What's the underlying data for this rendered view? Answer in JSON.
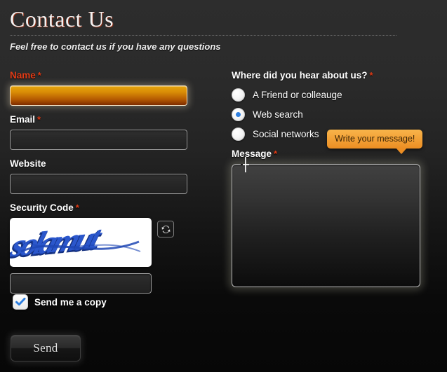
{
  "header": {
    "title": "Contact Us",
    "subtitle": "Feel free to contact us if you have any questions"
  },
  "form": {
    "name": {
      "label": "Name",
      "required_mark": "*",
      "value": "",
      "placeholder": ""
    },
    "email": {
      "label": "Email",
      "required_mark": "*",
      "value": "",
      "placeholder": ""
    },
    "website": {
      "label": "Website",
      "required_mark": "",
      "value": "",
      "placeholder": ""
    },
    "security_code": {
      "label": "Security Code",
      "required_mark": "*",
      "value": "",
      "placeholder": "",
      "captcha_text": "solamut",
      "refresh_icon": "refresh-icon"
    },
    "send_copy": {
      "label": "Send me a copy",
      "checked": true,
      "check_icon": "check-icon"
    },
    "submit": {
      "label": "Send"
    }
  },
  "survey": {
    "label": "Where did you hear about us?",
    "required_mark": "*",
    "options": [
      {
        "label": "A Friend or colleauge",
        "selected": false
      },
      {
        "label": "Web search",
        "selected": true
      },
      {
        "label": "Social networks",
        "selected": false
      }
    ]
  },
  "message": {
    "label": "Message",
    "required_mark": "*",
    "value": "",
    "placeholder": "",
    "tooltip": "Write your message!"
  },
  "colors": {
    "accent_orange": "#ec8e23",
    "required_red": "#e03b16",
    "radio_dot_blue": "#2e7fe0",
    "check_blue": "#2e7fe0",
    "captcha_blue": "#1e46b4",
    "background_top": "#2d2d2d",
    "background_bottom": "#070707"
  }
}
